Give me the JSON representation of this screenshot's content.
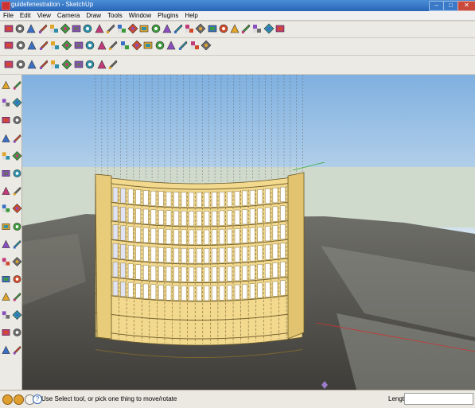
{
  "window": {
    "title": "guidefenestration - SketchUp",
    "controls": [
      "–",
      "□",
      "✕"
    ]
  },
  "menu": [
    "File",
    "Edit",
    "View",
    "Camera",
    "Draw",
    "Tools",
    "Window",
    "Plugins",
    "Help"
  ],
  "status": {
    "message": "Use Select tool, or pick one thing to move/rotate",
    "help_icon": "?",
    "length_label": "Length",
    "length_value": ""
  },
  "colors": {
    "sky": "#a9c8e6",
    "facade_frame": "#f2d98e",
    "glass": "#ffffff",
    "ground": "#5b5a55",
    "title_bar": "#2a64b8"
  },
  "icons": {
    "toolbar_row1": [
      "select-icon",
      "pencil-icon",
      "rectangle-icon",
      "circle-icon",
      "arc-icon",
      "eraser-icon",
      "paint-icon",
      "tape-icon",
      "push-pull-icon",
      "move-icon",
      "rotate-icon",
      "follow-me-icon",
      "offset-icon",
      "orbit-icon",
      "pan-icon",
      "zoom-icon",
      "zoom-extents-icon",
      "dimensions-icon",
      "protractor-icon",
      "text-icon",
      "axes-icon",
      "3d-text-icon",
      "section-icon",
      "walk-icon",
      "look-around-icon"
    ],
    "toolbar_row2": [
      "sandbox-icon",
      "smoove-icon",
      "stamp-icon",
      "drape-icon",
      "add-detail-icon",
      "flip-edge-icon",
      "component-icon",
      "group-icon",
      "geo-location-icon",
      "photo-texture-icon",
      "shadow-icon",
      "fog-icon",
      "3d-warehouse-icon",
      "extension-icon",
      "layer-icon",
      "style-icon",
      "scene-icon",
      "camera-icon"
    ],
    "toolbar_row3": [
      "iso-view-icon",
      "top-view-icon",
      "front-view-icon",
      "right-view-icon",
      "back-view-icon",
      "left-view-icon",
      "xray-icon",
      "wireframe-icon",
      "hidden-line-icon",
      "shaded-icon"
    ]
  }
}
